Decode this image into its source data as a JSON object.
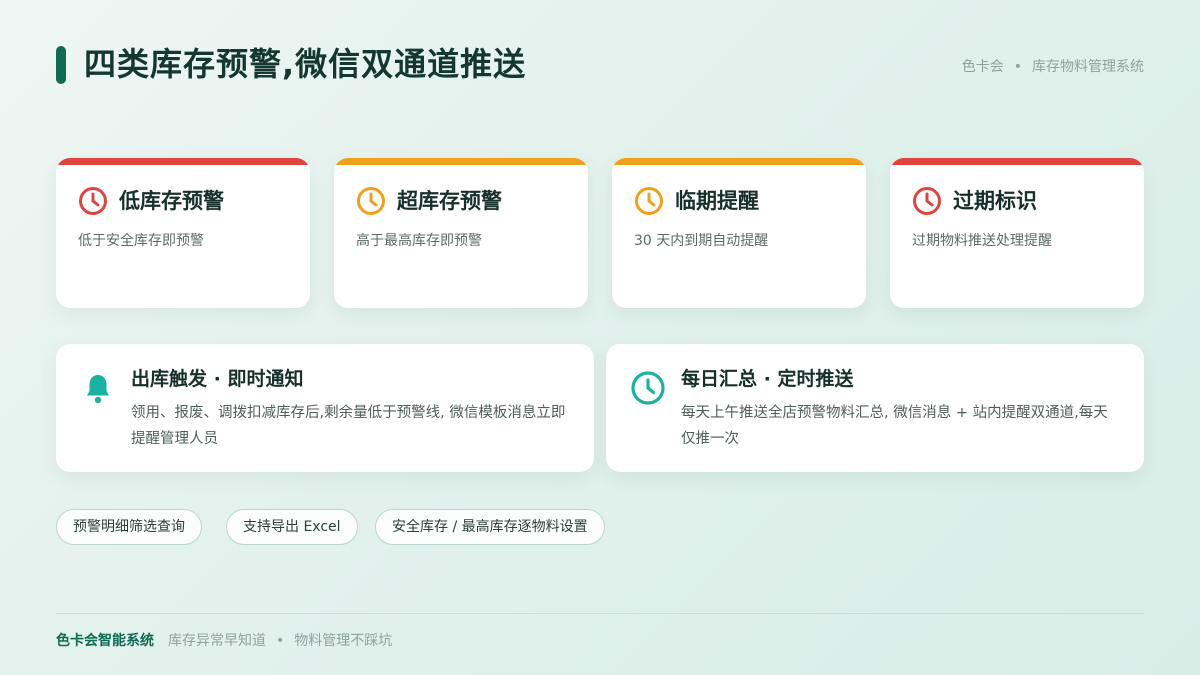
{
  "header": {
    "title": "四类库存预警,微信双通道推送",
    "brand_name": "色卡会",
    "brand_separator": "•",
    "brand_system": "库存物料管理系统"
  },
  "alert_cards": [
    {
      "title": "低库存预警",
      "desc": "低于安全库存即预警",
      "color": "#e0443e",
      "icon": "clock-icon"
    },
    {
      "title": "超库存预警",
      "desc": "高于最高库存即预警",
      "color": "#f0a01a",
      "icon": "clock-icon"
    },
    {
      "title": "临期提醒",
      "desc": "30 天内到期自动提醒",
      "color": "#f0a01a",
      "icon": "clock-icon"
    },
    {
      "title": "过期标识",
      "desc": "过期物料推送处理提醒",
      "color": "#e0443e",
      "icon": "clock-icon"
    }
  ],
  "push_cards": [
    {
      "title": "出库触发 · 即时通知",
      "desc": "领用、报废、调拨扣减库存后,剩余量低于预警线, 微信模板消息立即提醒管理人员",
      "color": "#19b3a3",
      "icon": "bell-icon"
    },
    {
      "title": "每日汇总 · 定时推送",
      "desc": "每天上午推送全店预警物料汇总, 微信消息 + 站内提醒双通道,每天仅推一次",
      "color": "#19b3a3",
      "icon": "clock-icon"
    }
  ],
  "tags": [
    "预警明细筛选查询",
    "支持导出 Excel",
    "安全库存 / 最高库存逐物料设置"
  ],
  "footer": {
    "brand": "色卡会智能系统",
    "slogan_1": "库存异常早知道",
    "separator": "•",
    "slogan_2": "物料管理不踩坑"
  },
  "colors": {
    "primary": "#0f6b52",
    "red": "#e0443e",
    "orange": "#f0a01a",
    "teal": "#19b3a3"
  }
}
